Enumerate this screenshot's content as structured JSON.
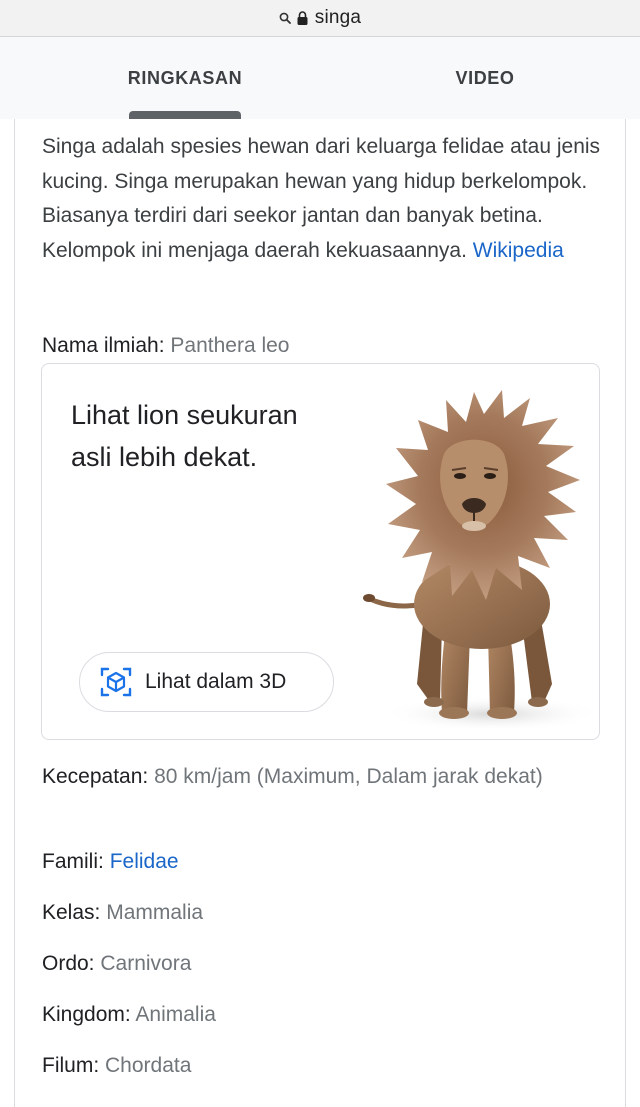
{
  "browser": {
    "url_text": "singa",
    "icons": [
      "search-icon",
      "lock-icon"
    ]
  },
  "tabs": [
    {
      "label": "RINGKASAN",
      "active": true
    },
    {
      "label": "VIDEO",
      "active": false
    }
  ],
  "summary": {
    "text": "Singa adalah spesies hewan dari keluarga felidae atau jenis kucing. Singa merupakan hewan yang hidup berkelompok. Biasanya terdiri dari seekor jantan dan banyak betina. Kelompok ini menjaga daerah kekuasaannya. ",
    "source_link": "Wikipedia"
  },
  "scientific_name": {
    "label": "Nama ilmiah:",
    "value": "Panthera leo"
  },
  "ar_card": {
    "title": "Lihat lion seukuran asli lebih dekat.",
    "button_label": "Lihat dalam 3D",
    "icon": "view-in-3d-icon",
    "image": "lion-3d-image"
  },
  "facts": [
    {
      "label": "Kecepatan:",
      "value": "80 km/jam (Maximum, Dalam jarak dekat)",
      "is_link": false
    },
    {
      "label": "Famili:",
      "value": "Felidae",
      "is_link": true
    },
    {
      "label": "Kelas:",
      "value": "Mammalia",
      "is_link": false
    },
    {
      "label": "Ordo:",
      "value": "Carnivora",
      "is_link": false
    },
    {
      "label": "Kingdom:",
      "value": "Animalia",
      "is_link": false
    },
    {
      "label": "Filum:",
      "value": "Chordata",
      "is_link": false
    }
  ],
  "colors": {
    "link": "#1a66c9",
    "muted": "#70757a",
    "tab_indicator": "#5f6368"
  }
}
